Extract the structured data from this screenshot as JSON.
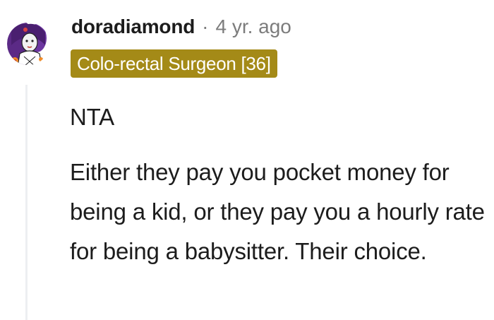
{
  "comment": {
    "avatar_icon": "user-avatar-icon",
    "username": "doradiamond",
    "separator": "·",
    "timestamp": "4 yr. ago",
    "flair": "Colo-rectal Surgeon [36]",
    "flair_color": "#a48a17",
    "paragraphs": [
      "NTA",
      "Either they pay you pocket money for being a kid, or they pay you a hourly rate for being a babysitter. Their choice."
    ]
  }
}
